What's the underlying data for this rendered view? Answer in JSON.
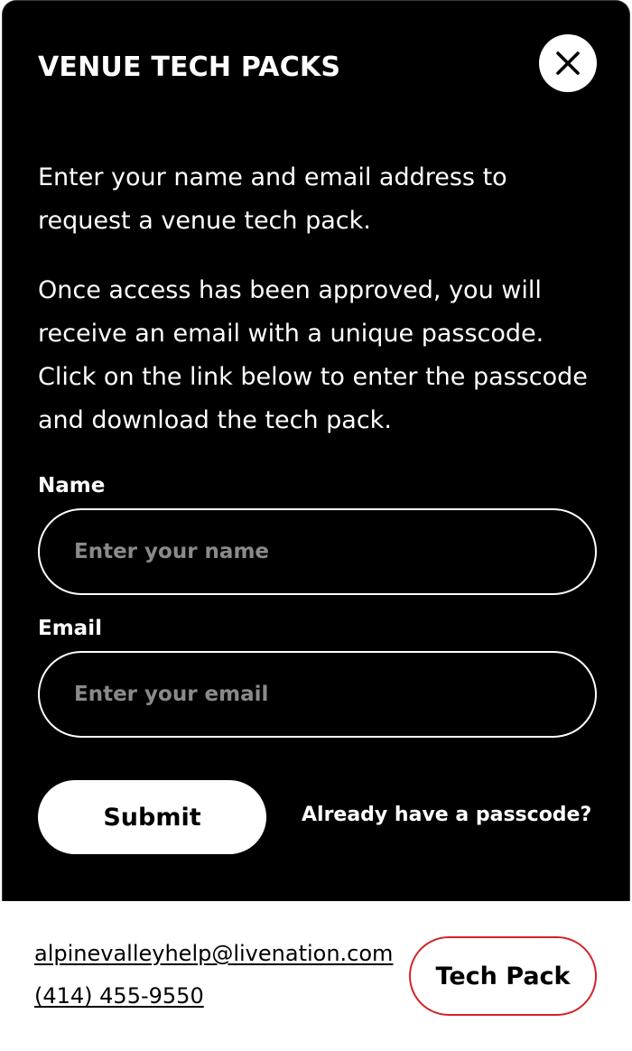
{
  "modal": {
    "title": "VENUE TECH PACKS",
    "intro_1": "Enter your name and email address to request a venue tech pack.",
    "intro_2": "Once access has been approved, you will receive an email with a unique passcode. Click on the link below to enter the passcode and download the tech pack.",
    "close_icon": "close-icon",
    "name_label": "Name",
    "name_placeholder": "Enter your name",
    "name_value": "",
    "email_label": "Email",
    "email_placeholder": "Enter your email",
    "email_value": "",
    "submit_label": "Submit",
    "passcode_link": "Already have a passcode?"
  },
  "footer": {
    "email": "alpinevalleyhelp@livenation.com",
    "phone": "(414) 455-9550",
    "tech_pack_label": "Tech Pack"
  },
  "colors": {
    "modal_background": "#000000",
    "text_on_dark": "#ffffff",
    "placeholder": "#8a8a8a",
    "accent_border": "#d2232a"
  }
}
